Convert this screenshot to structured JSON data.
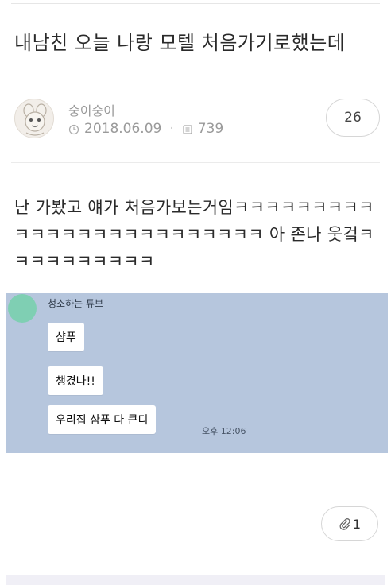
{
  "post": {
    "title": "내남친 오늘 나랑 모텔 처음가기로했는데",
    "author": "숭이숭이",
    "date": "2018.06.09",
    "views": "739",
    "comment_count": "26",
    "body": "난 가봤고 얘가 처음가보는거임ㅋㅋㅋㅋㅋㅋㅋㅋㅋㅋㅋㅋㅋㅋㅋㅋㅋㅋㅋㅋㅋㅋㅋㅋㅋ 아 존나 웃겈ㅋㅋㅋㅋㅋㅋㅋㅋㅋㅋ",
    "like_count": "1"
  },
  "chat": {
    "sender": "청소하는 튜브",
    "messages": [
      "샴푸",
      "챙겼나!!",
      "우리집 샴푸 다 큰디"
    ],
    "time": "오후 12:06"
  },
  "colors": {
    "chat_background": "#b6c6dd",
    "chat_avatar": "#7fcfb3"
  },
  "icons": {
    "clock": "clock-icon",
    "views": "views-icon",
    "clip": "paperclip-icon"
  }
}
